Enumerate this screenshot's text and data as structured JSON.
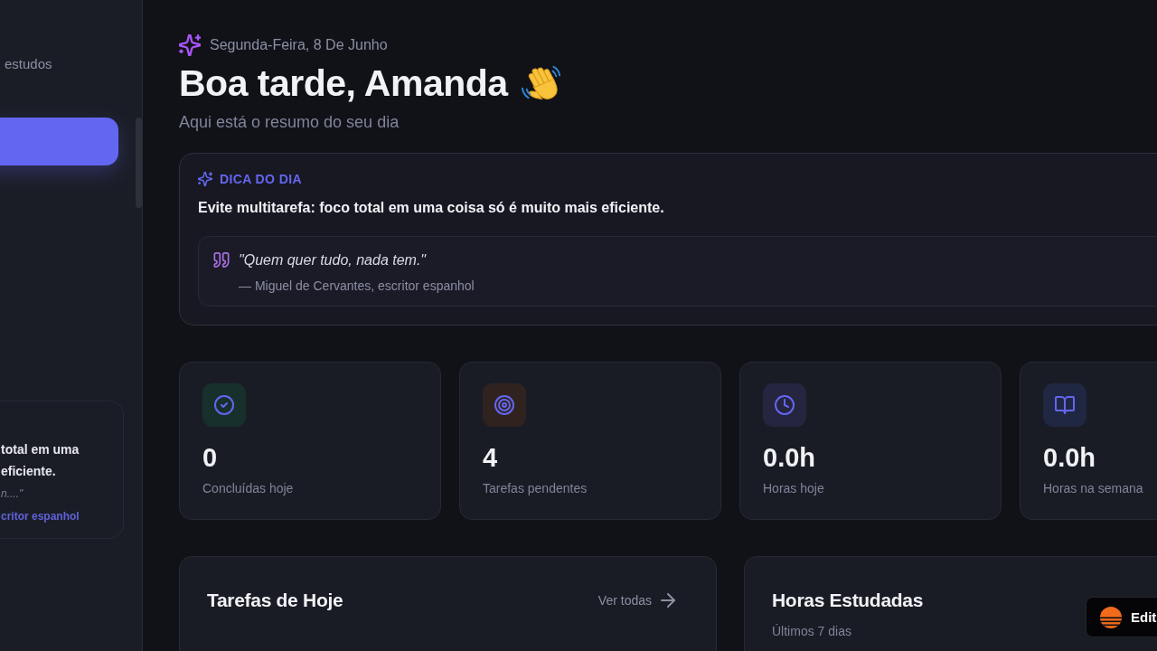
{
  "sidebar": {
    "subtitle": "estudos",
    "nav_items": [
      {
        "selected": true
      }
    ],
    "tip_card": {
      "lines": [
        "total em uma",
        "eficiente."
      ],
      "quote": "n....\"",
      "author": "critor espanhol"
    }
  },
  "header": {
    "date": "Segunda-Feira, 8 De Junho",
    "greeting": "Boa tarde, Amanda",
    "subtitle": "Aqui está o resumo do seu dia"
  },
  "tip": {
    "label": "DICA DO DIA",
    "text": "Evite multitarefa: foco total em uma coisa só é muito mais eficiente.",
    "quote": "\"Quem quer tudo, nada tem.\"",
    "author": "— Miguel de Cervantes, escritor espanhol"
  },
  "stats": [
    {
      "kind": "check",
      "value": "0",
      "label": "Concluídas hoje",
      "color": "#18302c"
    },
    {
      "kind": "target",
      "value": "4",
      "label": "Tarefas pendentes",
      "color": "#30231f"
    },
    {
      "kind": "clock",
      "value": "0.0h",
      "label": "Horas hoje",
      "color": "#25253f"
    },
    {
      "kind": "book",
      "value": "0.0h",
      "label": "Horas na semana",
      "color": "#1f2742"
    }
  ],
  "tasks_card": {
    "title": "Tarefas de Hoje",
    "link": "Ver todas"
  },
  "hours_card": {
    "title": "Horas Estudadas",
    "subtitle": "Últimos 7 dias"
  },
  "edit_badge": {
    "label": "Edit"
  }
}
